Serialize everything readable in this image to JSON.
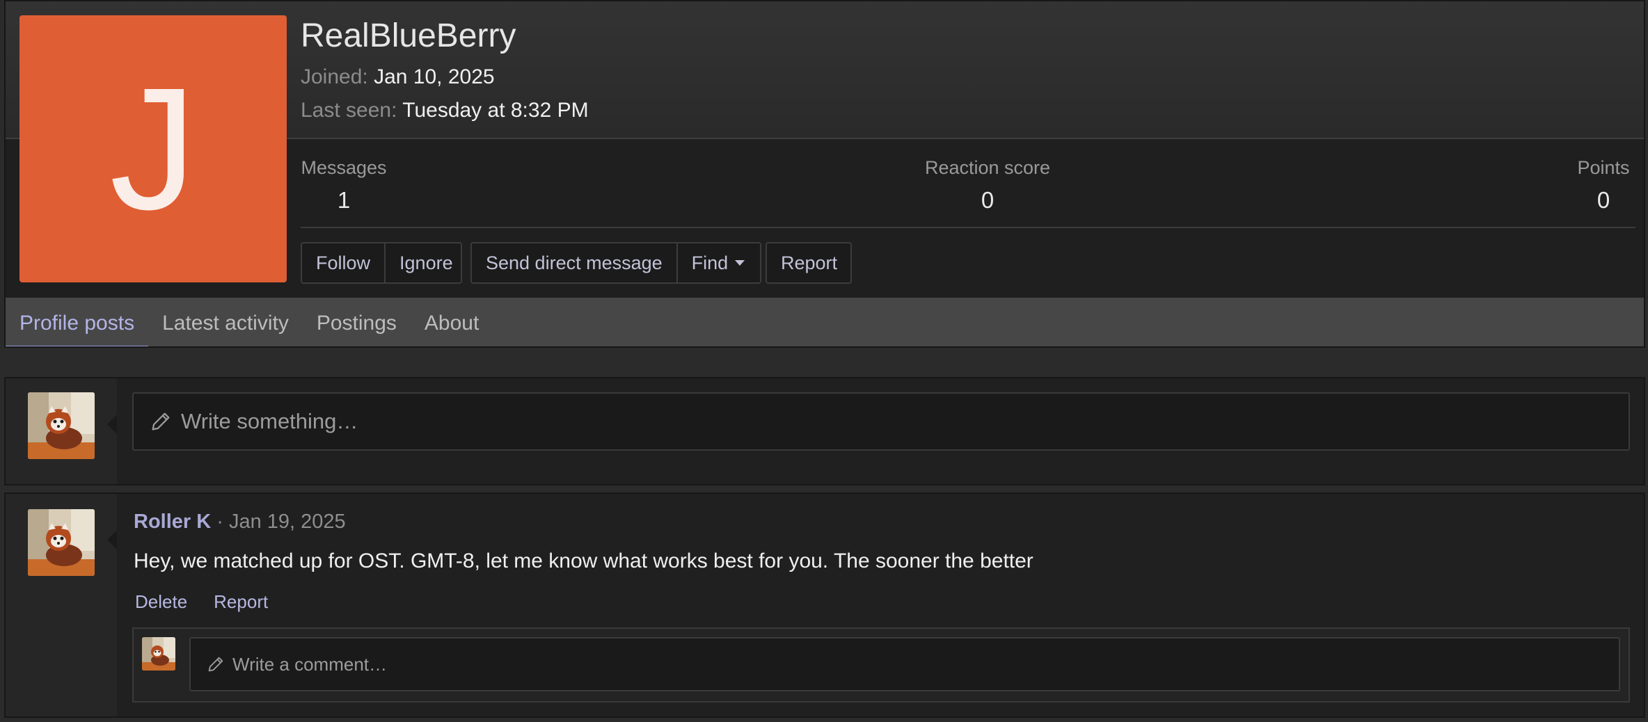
{
  "profile": {
    "avatar_letter": "J",
    "avatar_color": "#e05e33",
    "username": "RealBlueBerry",
    "joined_label": "Joined:",
    "joined_value": "Jan 10, 2025",
    "last_seen_label": "Last seen:",
    "last_seen_value": "Tuesday at 8:32 PM",
    "stats": {
      "messages_label": "Messages",
      "messages_value": "1",
      "reaction_label": "Reaction score",
      "reaction_value": "0",
      "points_label": "Points",
      "points_value": "0"
    },
    "buttons": {
      "follow": "Follow",
      "ignore": "Ignore",
      "send_dm": "Send direct message",
      "find": "Find",
      "report": "Report"
    }
  },
  "tabs": [
    {
      "label": "Profile posts",
      "active": true
    },
    {
      "label": "Latest activity",
      "active": false
    },
    {
      "label": "Postings",
      "active": false
    },
    {
      "label": "About",
      "active": false
    }
  ],
  "composer": {
    "placeholder": "Write something…",
    "icon": "pencil-icon"
  },
  "post": {
    "author": "Roller K",
    "separator": " · ",
    "date": "Jan 19, 2025",
    "text": "Hey, we matched up for OST. GMT-8, let me know what works best for you. The sooner the better",
    "actions": {
      "delete": "Delete",
      "report": "Report"
    },
    "comment_placeholder": "Write a comment…"
  },
  "colors": {
    "accent": "#9a9ce0",
    "link": "#b7b8e2",
    "background": "#2b2b2b"
  }
}
